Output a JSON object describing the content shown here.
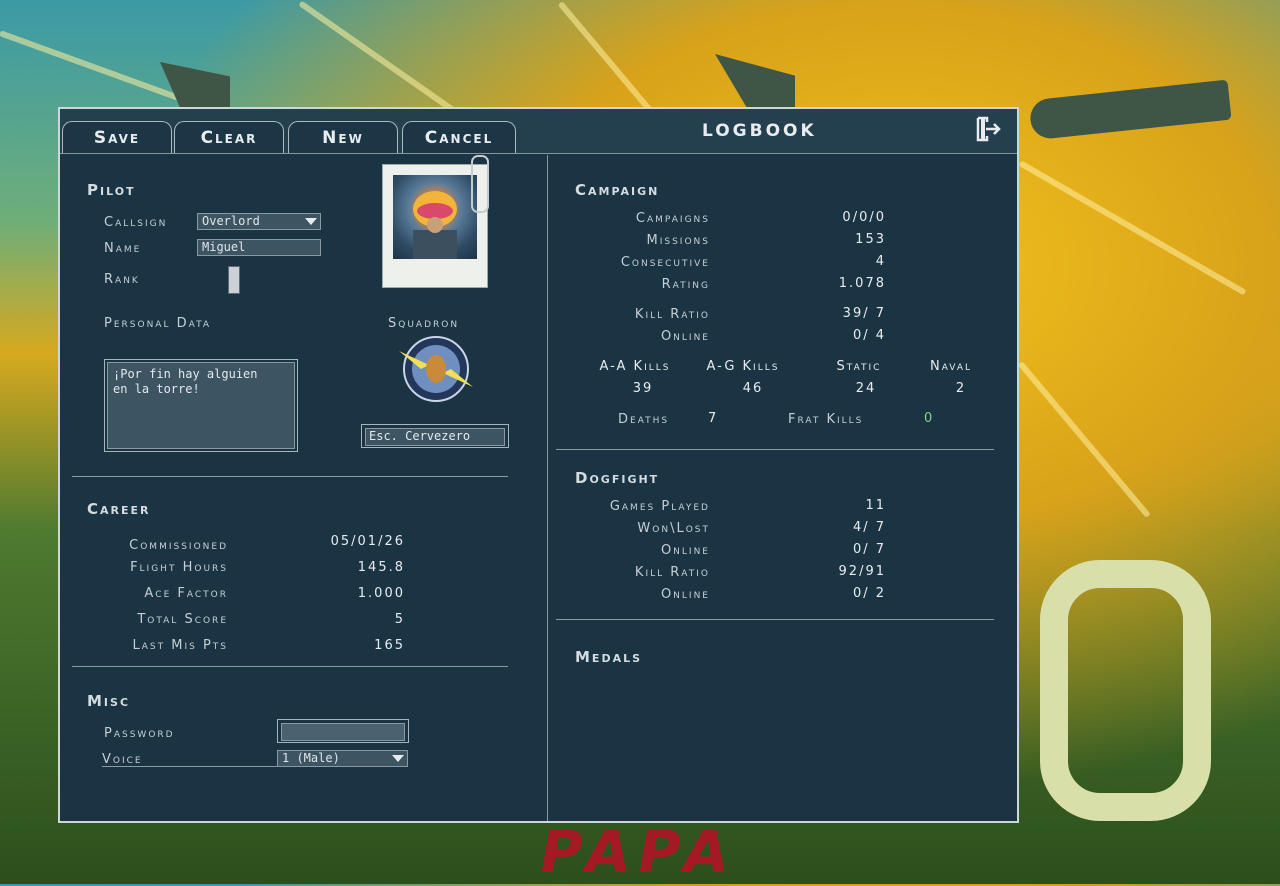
{
  "toolbar": {
    "tabs": [
      "Save",
      "Clear",
      "New",
      "Cancel"
    ],
    "title": "LOGBOOK"
  },
  "background": {
    "letters": "PAPA"
  },
  "pilot": {
    "heading": "Pilot",
    "callsign_label": "Callsign",
    "callsign_value": "Overlord",
    "name_label": "Name",
    "name_value": "Miguel",
    "rank_label": "Rank",
    "personal_data_label": "Personal Data",
    "personal_data_value": "¡Por fin hay alguien\nen la torre!",
    "squadron_label": "Squadron",
    "squadron_value": "Esc. Cervezero"
  },
  "career": {
    "heading": "Career",
    "rows": [
      {
        "label": "Commissioned",
        "value": "05/01/26"
      },
      {
        "label": "Flight Hours",
        "value": "145.8"
      },
      {
        "label": "Ace Factor",
        "value": "1.000"
      },
      {
        "label": "Total Score",
        "value": "5"
      },
      {
        "label": "Last Mis Pts",
        "value": "165"
      }
    ]
  },
  "misc": {
    "heading": "Misc",
    "password_label": "Password",
    "voice_label": "Voice",
    "voice_value": "1 (Male)"
  },
  "campaign": {
    "heading": "Campaign",
    "rows": [
      {
        "label": "Campaigns",
        "value": "0/0/0"
      },
      {
        "label": "Missions",
        "value": "153"
      },
      {
        "label": "Consecutive",
        "value": "4"
      },
      {
        "label": "Rating",
        "value": "1.078"
      }
    ],
    "kill_ratio_label": "Kill Ratio",
    "kill_ratio_value": "39/ 7",
    "online_label": "Online",
    "online_value": "0/ 4",
    "kills_headers": [
      "A-A Kills",
      "A-G Kills",
      "Static",
      "Naval"
    ],
    "kills_values": [
      "39",
      "46",
      "24",
      "2"
    ],
    "deaths_label": "Deaths",
    "deaths_value": "7",
    "frat_kills_label": "Frat Kills",
    "frat_kills_value": "0",
    "frat_color": "#7fd68a"
  },
  "dogfight": {
    "heading": "Dogfight",
    "rows": [
      {
        "label": "Games Played",
        "value": "11"
      },
      {
        "label": "Won\\Lost",
        "value": "4/ 7"
      },
      {
        "label": "Online",
        "value": "0/ 7"
      },
      {
        "label": "Kill Ratio",
        "value": "92/91"
      },
      {
        "label": "Online",
        "value": "0/ 2"
      }
    ]
  },
  "medals": {
    "heading": "Medals"
  }
}
